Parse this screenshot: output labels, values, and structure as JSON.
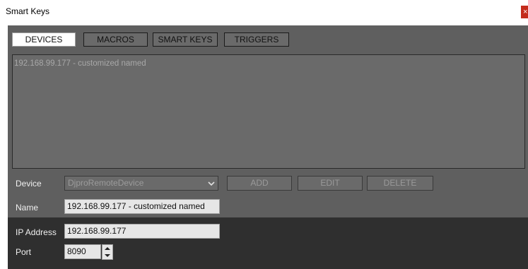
{
  "window": {
    "title": "Smart Keys",
    "close_glyph": "×"
  },
  "tabs": [
    {
      "label": "DEVICES",
      "active": true
    },
    {
      "label": "MACROS",
      "active": false
    },
    {
      "label": "SMART KEYS",
      "active": false
    },
    {
      "label": "TRIGGERS",
      "active": false
    }
  ],
  "device_list": {
    "items": [
      "192.168.99.177 - customized named"
    ]
  },
  "form": {
    "device_label": "Device",
    "device_value": "DjproRemoteDevice",
    "add_label": "ADD",
    "edit_label": "EDIT",
    "delete_label": "DELETE",
    "name_label": "Name",
    "name_value": "192.168.99.177 - customized named",
    "ip_label": "IP Address",
    "ip_value": "192.168.99.177",
    "port_label": "Port",
    "port_value": "8090"
  },
  "colors": {
    "panel_bg": "#5f5f5f",
    "network_bg": "#2f2f2f",
    "close_red": "#c42b1c"
  },
  "icons": {
    "close": "close-icon",
    "dropdown": "chevron-down-icon",
    "spin_up": "spin-up-icon",
    "spin_down": "spin-down-icon"
  }
}
